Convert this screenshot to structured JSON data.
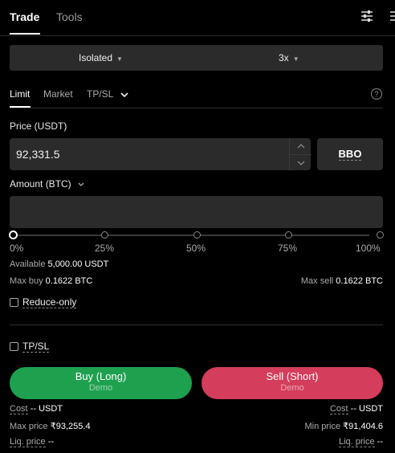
{
  "tabs": {
    "trade": "Trade",
    "tools": "Tools"
  },
  "margin": {
    "mode": "Isolated",
    "leverage": "3x"
  },
  "order_types": {
    "limit": "Limit",
    "market": "Market",
    "tpsl": "TP/SL"
  },
  "help": "?",
  "price": {
    "label": "Price (USDT)",
    "value": "92,331.5",
    "bbo": "BBO"
  },
  "amount": {
    "label": "Amount (BTC)",
    "value": ""
  },
  "slider": {
    "value_percent": 0,
    "ticks": [
      "0%",
      "25%",
      "50%",
      "75%",
      "100%"
    ]
  },
  "available": {
    "label": "Available",
    "value": "5,000.00 USDT"
  },
  "max_buy": {
    "label": "Max buy",
    "value": "0.1622 BTC"
  },
  "max_sell": {
    "label": "Max sell",
    "value": "0.1622 BTC"
  },
  "reduce_only": "Reduce-only",
  "tpsl_check": "TP/SL",
  "buy": {
    "label": "Buy (Long)",
    "sub": "Demo"
  },
  "sell": {
    "label": "Sell (Short)",
    "sub": "Demo"
  },
  "buy_info": {
    "cost_label": "Cost",
    "cost_value": "-- USDT",
    "price_label": "Max price",
    "price_value": "₹93,255.4",
    "liq_label": "Liq. price",
    "liq_value": "--"
  },
  "sell_info": {
    "cost_label": "Cost",
    "cost_value": "-- USDT",
    "price_label": "Min price",
    "price_value": "₹91,404.6",
    "liq_label": "Liq. price",
    "liq_value": "--"
  },
  "icons": {
    "settings": "sliders-icon",
    "menu": "menu-icon"
  }
}
